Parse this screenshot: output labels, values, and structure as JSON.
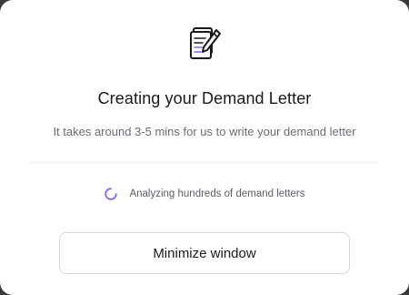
{
  "dialog": {
    "title": "Creating your Demand Letter",
    "subtitle": "It takes around 3-5 mins for us to write your demand letter",
    "icon": "document-pen-icon",
    "status": {
      "icon": "loading-spinner-icon",
      "text": "Analyzing hundreds of demand letters"
    },
    "minimize_button_label": "Minimize window"
  },
  "colors": {
    "spinner_accent": "#7c6cf0",
    "text_primary": "#1a1a1a",
    "text_secondary": "#6b6b76",
    "border": "#d6d6db"
  }
}
